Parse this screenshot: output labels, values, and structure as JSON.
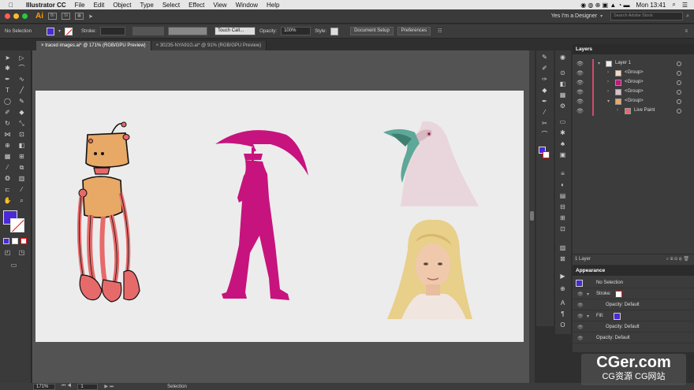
{
  "macbar": {
    "app_name": "Illustrator CC",
    "menus": [
      "File",
      "Edit",
      "Object",
      "Type",
      "Select",
      "Effect",
      "View",
      "Window",
      "Help"
    ],
    "clock": "Mon 13:41"
  },
  "appbar": {
    "logo": "Ai",
    "workspace": "Yes I'm a Designer",
    "search_placeholder": "Search Adobe Stock"
  },
  "control": {
    "selection_label": "No Selection",
    "stroke_label": "Stroke:",
    "brush_value": "Touch Call...",
    "opacity_label": "Opacity:",
    "opacity_value": "100%",
    "style_label": "Style:",
    "doc_setup": "Document Setup",
    "preferences": "Preferences",
    "fill_color": "#4b2ad6"
  },
  "tabs": [
    {
      "label": "traced images.ai* @ 171% (RGB/GPU Preview)"
    },
    {
      "label": "30235-NYA91G.ai* @ 91% (RGB/GPU Preview)"
    }
  ],
  "status": {
    "zoom": "171%",
    "artboard": "1",
    "tool": "Selection"
  },
  "layers": {
    "title": "Layers",
    "rows": [
      {
        "label": "Layer 1"
      },
      {
        "label": "<Group>"
      },
      {
        "label": "<Group>"
      },
      {
        "label": "<Group>"
      },
      {
        "label": "<Group>"
      },
      {
        "label": "Live Paint"
      }
    ],
    "footer": "1 Layer"
  },
  "appearance": {
    "title": "Appearance",
    "selection": "No Selection",
    "stroke": "Stroke:",
    "stroke_opacity": "Opacity: Default",
    "fill": "Fill:",
    "fill_opacity": "Opacity: Default",
    "opacity": "Opacity: Default"
  },
  "watermark": {
    "line1": "CGer.com",
    "line2": "CG资源 CG网站"
  },
  "colors": {
    "magenta": "#c7137e",
    "robot_body": "#e8a866",
    "robot_legs": "#e76a6a",
    "accent_fill": "#4b2ad6"
  }
}
